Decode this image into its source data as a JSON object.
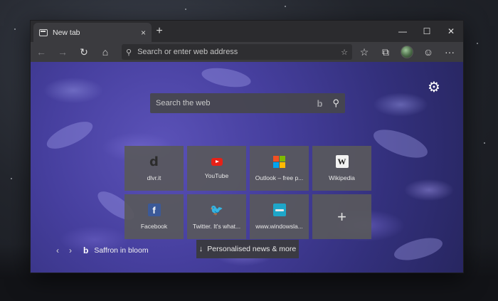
{
  "tab": {
    "title": "New tab",
    "close": "×",
    "new_tab": "+"
  },
  "window_controls": {
    "minimize": "—",
    "maximize": "☐",
    "close": "✕"
  },
  "toolbar": {
    "back": "←",
    "forward": "→",
    "refresh": "↻",
    "home": "⌂",
    "address_placeholder": "Search or enter web address",
    "search_glyph": "⚲",
    "favorite": "☆",
    "favorites_hub": "☆",
    "collections": "⧉",
    "feedback": "☺",
    "more": "···"
  },
  "search": {
    "placeholder": "Search the web",
    "bing_glyph": "b",
    "search_glyph": "⚲"
  },
  "settings": {
    "glyph": "⚙"
  },
  "tiles": [
    {
      "label": "dlvr.it",
      "icon": "d"
    },
    {
      "label": "YouTube",
      "icon": "youtube-icon"
    },
    {
      "label": "Outlook – free p...",
      "icon": "microsoft-icon"
    },
    {
      "label": "Wikipedia",
      "icon": "W"
    },
    {
      "label": "Facebook",
      "icon": "f"
    },
    {
      "label": "Twitter. It's what...",
      "icon": "🐦"
    },
    {
      "label": "www.windowsla...",
      "icon": "windows-central-icon"
    }
  ],
  "add_tile": {
    "glyph": "+"
  },
  "image_info": {
    "prev": "‹",
    "next": "›",
    "bing_glyph": "b",
    "caption": "Saffron in bloom"
  },
  "news": {
    "label": "Personalised news & more",
    "glyph": "↓"
  },
  "colors": {
    "ms_red": "#f25022",
    "ms_green": "#7fba00",
    "ms_blue": "#00a4ef",
    "ms_yellow": "#ffb900",
    "youtube": "#e62117",
    "facebook": "#3b5998",
    "twitter": "#1da1f2"
  }
}
